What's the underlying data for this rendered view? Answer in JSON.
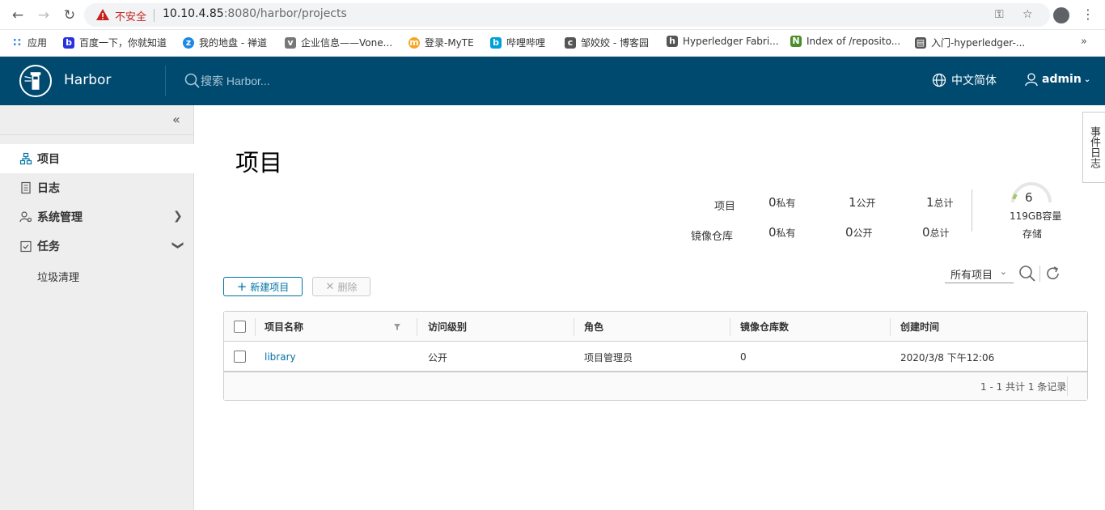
{
  "browser": {
    "insecure_label": "不安全",
    "url_host": "10.10.4.85",
    "url_path": ":8080/harbor/projects",
    "bookmarks": [
      {
        "label": "应用",
        "color": "#4285f4"
      },
      {
        "label": "百度一下，你就知道",
        "color": "#2932e1"
      },
      {
        "label": "我的地盘 - 禅道",
        "color": "#1e88e5"
      },
      {
        "label": "企业信息——Vone...",
        "color": "#777777"
      },
      {
        "label": "登录-MyTE",
        "color": "#f5a623"
      },
      {
        "label": "哔哩哔哩",
        "color": "#00a1d6"
      },
      {
        "label": "邹姣姣 - 博客园",
        "color": "#555555"
      },
      {
        "label": "Hyperledger Fabri...",
        "color": "#555555"
      },
      {
        "label": "Index of /reposito...",
        "color": "#4c8c2b"
      },
      {
        "label": "入门-hyperledger-...",
        "color": "#555555"
      }
    ]
  },
  "header": {
    "title": "Harbor",
    "search_placeholder": "搜索 Harbor...",
    "language": "中文简体",
    "user": "admin"
  },
  "sidebar": {
    "items": [
      {
        "label": "项目"
      },
      {
        "label": "日志"
      },
      {
        "label": "系统管理"
      },
      {
        "label": "任务"
      }
    ],
    "sub_items": [
      {
        "label": "垃圾清理"
      }
    ]
  },
  "event_log_tab": "事件日志",
  "main": {
    "title": "项目",
    "stats": {
      "projects_label": "项目",
      "repos_label": "镜像仓库",
      "projects": {
        "private": "0",
        "public": "1",
        "total": "1"
      },
      "repos": {
        "private": "0",
        "public": "0",
        "total": "0"
      },
      "private_unit": "私有",
      "public_unit": "公开",
      "total_unit": "总计",
      "storage_value": "6",
      "capacity_label": "119GB容量",
      "storage_label": "存储",
      "storage_used_fraction": 0.05
    },
    "buttons": {
      "new_project": "新建项目",
      "delete": "删除"
    },
    "filter_value": "所有项目",
    "table": {
      "columns": [
        "项目名称",
        "访问级别",
        "角色",
        "镜像仓库数",
        "创建时间"
      ],
      "rows": [
        {
          "name": "library",
          "access": "公开",
          "role": "项目管理员",
          "repo_count": "0",
          "created": "2020/3/8 下午12:06"
        }
      ],
      "pagination": "1 - 1 共计 1 条记录"
    }
  },
  "colors": {
    "header_bg": "#004a70",
    "accent": "#0072a3",
    "sidebar_bg": "#eeeeee",
    "storage_ring": "#9ccc65"
  }
}
